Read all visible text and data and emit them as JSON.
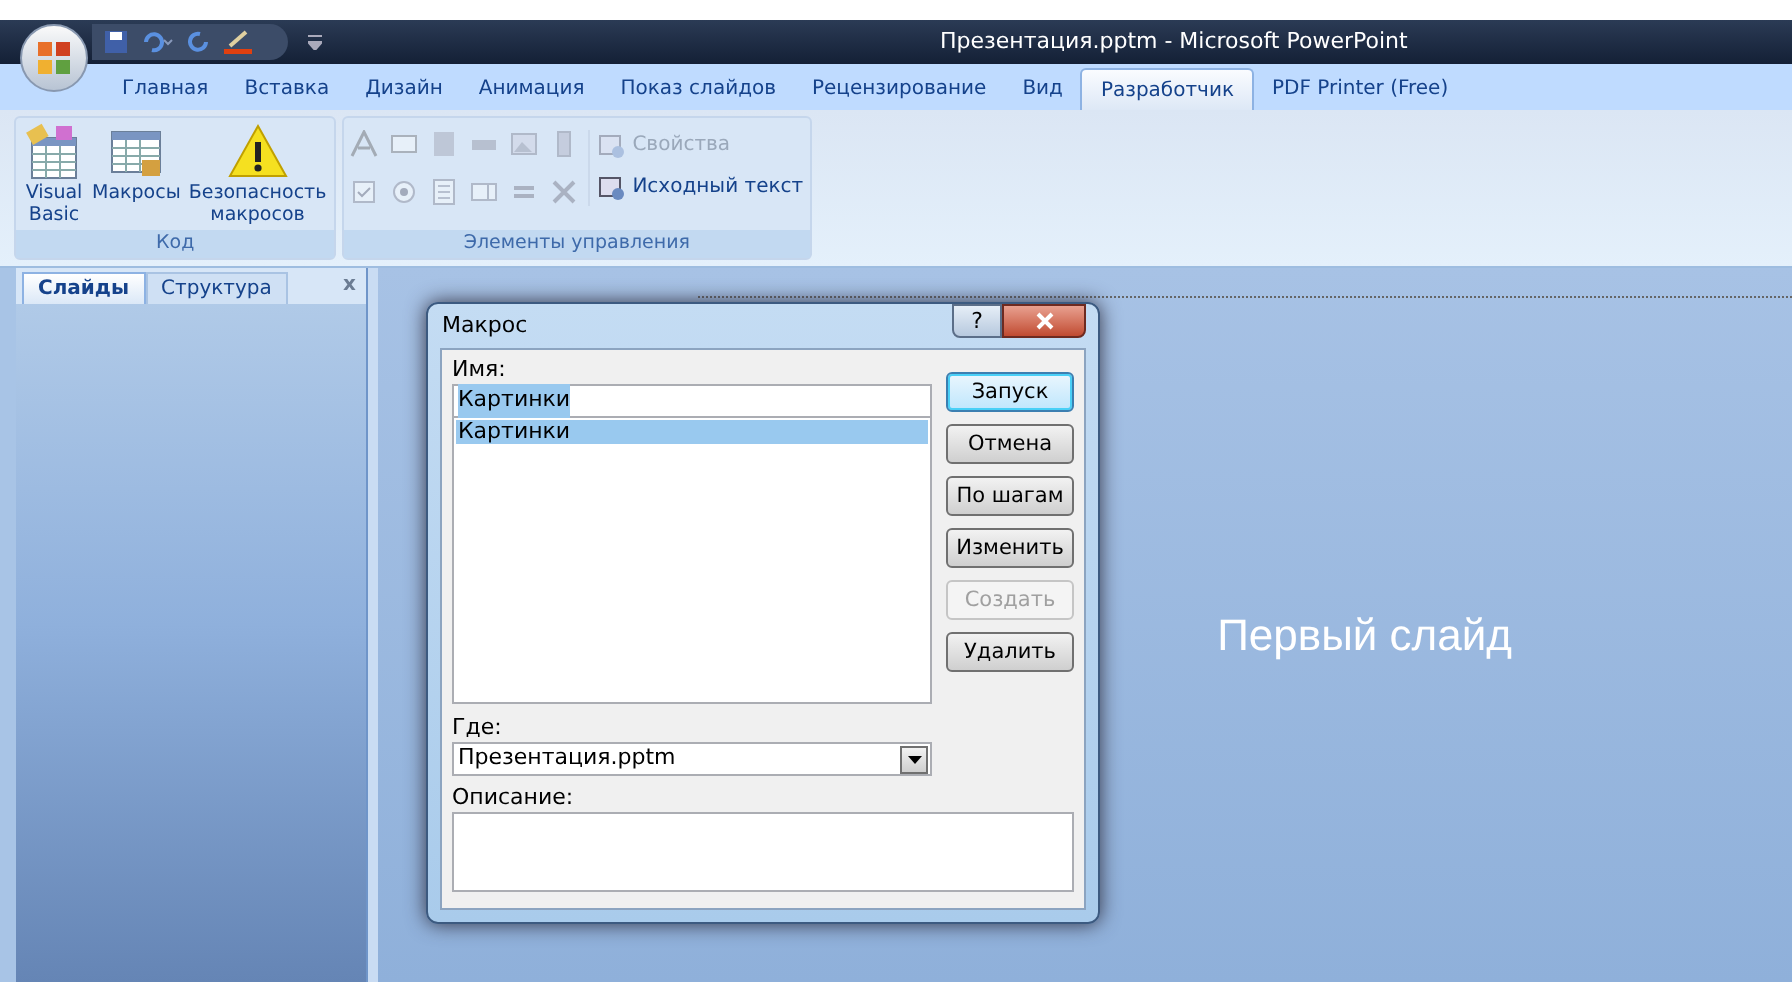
{
  "window": {
    "title": "Презентация.pptm - Microsoft PowerPoint"
  },
  "tabs": [
    {
      "label": "Главная",
      "selected": false
    },
    {
      "label": "Вставка",
      "selected": false
    },
    {
      "label": "Дизайн",
      "selected": false
    },
    {
      "label": "Анимация",
      "selected": false
    },
    {
      "label": "Показ слайдов",
      "selected": false
    },
    {
      "label": "Рецензирование",
      "selected": false
    },
    {
      "label": "Вид",
      "selected": false
    },
    {
      "label": "Разработчик",
      "selected": true
    },
    {
      "label": "PDF Printer (Free)",
      "selected": false
    }
  ],
  "ribbon": {
    "groups": [
      {
        "label": "Код",
        "buttons": [
          {
            "label": "Visual Basic",
            "kind": "vba"
          },
          {
            "label": "Макросы",
            "kind": "macros"
          },
          {
            "label": "Безопасность макросов",
            "kind": "security"
          }
        ]
      },
      {
        "label": "Элементы управления",
        "commands": [
          {
            "label": "Свойства",
            "disabled": true
          },
          {
            "label": "Исходный текст",
            "disabled": false
          }
        ]
      }
    ]
  },
  "pane": {
    "tabs": [
      {
        "label": "Слайды",
        "selected": true
      },
      {
        "label": "Структура",
        "selected": false
      }
    ],
    "close": "x"
  },
  "slide": {
    "title": "Первый слайд"
  },
  "dialog": {
    "title": "Макрос",
    "help": "?",
    "name_label": "Имя:",
    "name_value": "Картинки",
    "macros": [
      {
        "label": "Картинки",
        "selected": true
      }
    ],
    "where_label": "Где:",
    "where_value": "Презентация.pptm",
    "description_label": "Описание:",
    "buttons": [
      {
        "label": "Запуск",
        "disabled": false,
        "default": true
      },
      {
        "label": "Отмена",
        "disabled": false,
        "default": false
      },
      {
        "label": "По шагам",
        "disabled": false,
        "default": false
      },
      {
        "label": "Изменить",
        "disabled": false,
        "default": false
      },
      {
        "label": "Создать",
        "disabled": true,
        "default": false
      },
      {
        "label": "Удалить",
        "disabled": false,
        "default": false
      }
    ]
  }
}
